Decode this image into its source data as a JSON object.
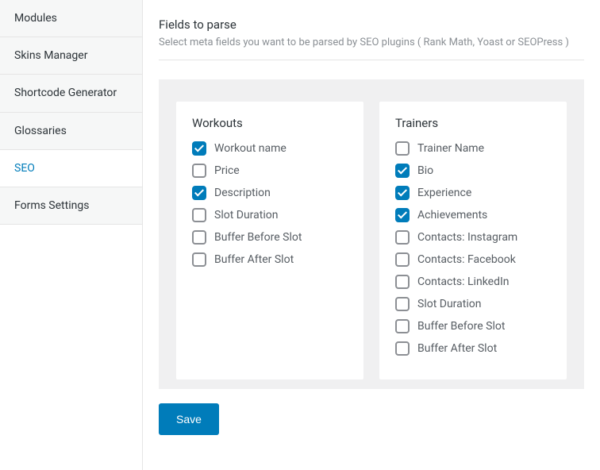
{
  "sidebar": {
    "items": [
      {
        "label": "Modules",
        "active": false
      },
      {
        "label": "Skins Manager",
        "active": false
      },
      {
        "label": "Shortcode Generator",
        "active": false
      },
      {
        "label": "Glossaries",
        "active": false
      },
      {
        "label": "SEO",
        "active": true
      },
      {
        "label": "Forms Settings",
        "active": false
      }
    ]
  },
  "header": {
    "title": "Fields to parse",
    "description": "Select meta fields you want to be parsed by SEO plugins ( Rank Math, Yoast or SEOPress )"
  },
  "groups": [
    {
      "title": "Workouts",
      "fields": [
        {
          "label": "Workout name",
          "checked": true
        },
        {
          "label": "Price",
          "checked": false
        },
        {
          "label": "Description",
          "checked": true
        },
        {
          "label": "Slot Duration",
          "checked": false
        },
        {
          "label": "Buffer Before Slot",
          "checked": false
        },
        {
          "label": "Buffer After Slot",
          "checked": false
        }
      ]
    },
    {
      "title": "Trainers",
      "fields": [
        {
          "label": "Trainer Name",
          "checked": false
        },
        {
          "label": "Bio",
          "checked": true
        },
        {
          "label": "Experience",
          "checked": true
        },
        {
          "label": "Achievements",
          "checked": true
        },
        {
          "label": "Contacts: Instagram",
          "checked": false
        },
        {
          "label": "Contacts: Facebook",
          "checked": false
        },
        {
          "label": "Contacts: LinkedIn",
          "checked": false
        },
        {
          "label": "Slot Duration",
          "checked": false
        },
        {
          "label": "Buffer Before Slot",
          "checked": false
        },
        {
          "label": "Buffer After Slot",
          "checked": false
        }
      ]
    }
  ],
  "actions": {
    "save_label": "Save"
  }
}
